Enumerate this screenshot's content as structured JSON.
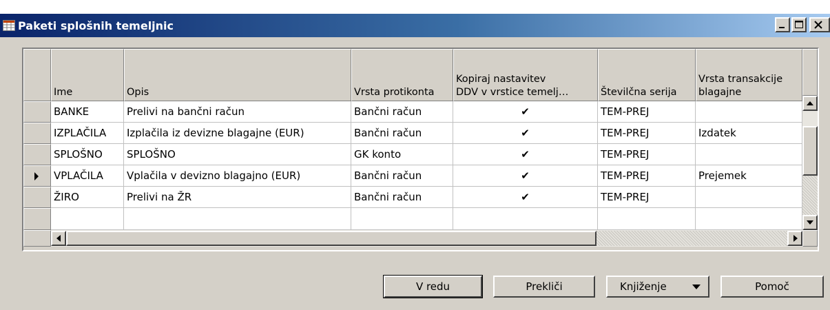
{
  "window": {
    "title": "Paketi splošnih temeljnic"
  },
  "columns": {
    "ime": "Ime",
    "opis": "Opis",
    "vrsta_protikonta": "Vrsta protikonta",
    "kopiraj_line1": "Kopiraj nastavitev",
    "kopiraj_line2": "DDV v vrstice temelj…",
    "stevilcna_serija": "Številčna serija",
    "vrsta_trans_line1": "Vrsta transakcije",
    "vrsta_trans_line2": "blagajne"
  },
  "rows": [
    {
      "ime": "BANKE",
      "opis": "Prelivi na bančni račun",
      "vrsta_protikonta": "Bančni račun",
      "kopiraj": "✔",
      "serija": "TEM-PREJ",
      "transakcija": ""
    },
    {
      "ime": "IZPLAČILA",
      "opis": "Izplačila iz devizne blagajne (EUR)",
      "vrsta_protikonta": "Bančni račun",
      "kopiraj": "✔",
      "serija": "TEM-PREJ",
      "transakcija": "Izdatek"
    },
    {
      "ime": "SPLOŠNO",
      "opis": "SPLOŠNO",
      "vrsta_protikonta": "GK konto",
      "kopiraj": "✔",
      "serija": "TEM-PREJ",
      "transakcija": ""
    },
    {
      "ime": "VPLAČILA",
      "opis": "Vplačila v devizno blagajno (EUR)",
      "vrsta_protikonta": "Bančni račun",
      "kopiraj": "✔",
      "serija": "TEM-PREJ",
      "transakcija": "Prejemek"
    },
    {
      "ime": "ŽIRO",
      "opis": "Prelivi na ŽR",
      "vrsta_protikonta": "Bančni račun",
      "kopiraj": "✔",
      "serija": "TEM-PREJ",
      "transakcija": ""
    },
    {
      "ime": "",
      "opis": "",
      "vrsta_protikonta": "",
      "kopiraj": "",
      "serija": "",
      "transakcija": ""
    }
  ],
  "selected_row_index": 3,
  "buttons": {
    "ok": "V redu",
    "cancel": "Prekliči",
    "posting": "Knjiženje",
    "help": "Pomoč"
  },
  "icons": {
    "title": "table-icon",
    "minimize": "minimize-icon",
    "maximize": "maximize-icon",
    "close": "close-icon",
    "row_pointer": "row-pointer-icon",
    "scroll_up": "arrow-up-icon",
    "scroll_down": "arrow-down-icon",
    "scroll_left": "arrow-left-icon",
    "scroll_right": "arrow-right-icon",
    "dropdown": "dropdown-arrow-icon"
  },
  "colors": {
    "titlebar_start": "#0a246a",
    "titlebar_end": "#a6caf0",
    "face": "#d4d0c8",
    "cell_bg": "#ffffff"
  }
}
